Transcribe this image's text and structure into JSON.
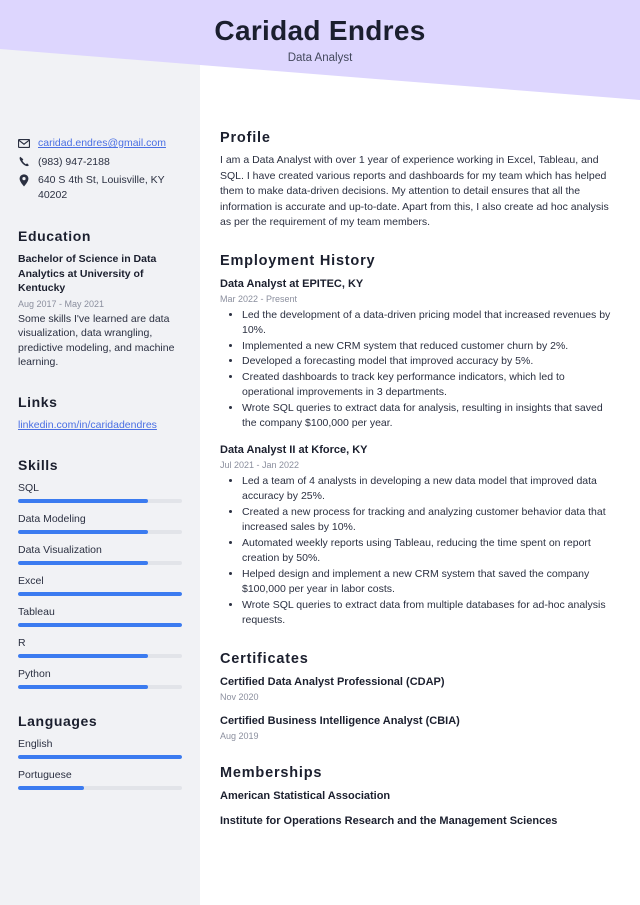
{
  "theme": {
    "band_color": "#ddd6fe",
    "sidebar_color": "#f1f2f5",
    "accent_bar": "#3b7bf0",
    "link_color": "#4a6fe3",
    "text_color": "#2b3041",
    "muted_color": "#8b8f9e"
  },
  "header": {
    "name": "Caridad Endres",
    "role": "Data Analyst"
  },
  "sidebar": {
    "contact": [
      {
        "icon": "envelope-icon",
        "text": "caridad.endres@gmail.com",
        "is_link": true
      },
      {
        "icon": "phone-icon",
        "text": "(983) 947-2188",
        "is_link": false
      },
      {
        "icon": "location-pin-icon",
        "text": "640 S 4th St, Louisville, KY 40202",
        "is_link": false
      }
    ],
    "education": {
      "heading": "Education",
      "title": "Bachelor of Science in Data Analytics at University of Kentucky",
      "date": "Aug 2017 - May 2021",
      "description": "Some skills I've learned are data visualization, data wrangling, predictive modeling, and machine learning."
    },
    "links": {
      "heading": "Links",
      "items": [
        {
          "label": "linkedin.com/in/caridadendres"
        }
      ]
    },
    "skills": {
      "heading": "Skills",
      "items": [
        {
          "label": "SQL",
          "level": 79
        },
        {
          "label": "Data Modeling",
          "level": 79
        },
        {
          "label": "Data Visualization",
          "level": 79
        },
        {
          "label": "Excel",
          "level": 100
        },
        {
          "label": "Tableau",
          "level": 100
        },
        {
          "label": "R",
          "level": 79
        },
        {
          "label": "Python",
          "level": 79
        }
      ]
    },
    "languages": {
      "heading": "Languages",
      "items": [
        {
          "label": "English",
          "level": 100
        },
        {
          "label": "Portuguese",
          "level": 40
        }
      ]
    }
  },
  "main": {
    "profile": {
      "heading": "Profile",
      "text": "I am a Data Analyst with over 1 year of experience working in Excel, Tableau, and SQL. I have created various reports and dashboards for my team which has helped them to make data-driven decisions. My attention to detail ensures that all the information is accurate and up-to-date. Apart from this, I also create ad hoc analysis as per the requirement of my team members."
    },
    "employment": {
      "heading": "Employment History",
      "jobs": [
        {
          "title": "Data Analyst at EPITEC, KY",
          "date": "Mar 2022 - Present",
          "bullets": [
            "Led the development of a data-driven pricing model that increased revenues by 10%.",
            "Implemented a new CRM system that reduced customer churn by 2%.",
            "Developed a forecasting model that improved accuracy by 5%.",
            "Created dashboards to track key performance indicators, which led to operational improvements in 3 departments.",
            "Wrote SQL queries to extract data for analysis, resulting in insights that saved the company $100,000 per year."
          ]
        },
        {
          "title": "Data Analyst II at Kforce, KY",
          "date": "Jul 2021 - Jan 2022",
          "bullets": [
            "Led a team of 4 analysts in developing a new data model that improved data accuracy by 25%.",
            "Created a new process for tracking and analyzing customer behavior data that increased sales by 10%.",
            "Automated weekly reports using Tableau, reducing the time spent on report creation by 50%.",
            "Helped design and implement a new CRM system that saved the company $100,000 per year in labor costs.",
            "Wrote SQL queries to extract data from multiple databases for ad-hoc analysis requests."
          ]
        }
      ]
    },
    "certificates": {
      "heading": "Certificates",
      "items": [
        {
          "title": "Certified Data Analyst Professional (CDAP)",
          "date": "Nov 2020"
        },
        {
          "title": "Certified Business Intelligence Analyst (CBIA)",
          "date": "Aug 2019"
        }
      ]
    },
    "memberships": {
      "heading": "Memberships",
      "items": [
        {
          "title": "American Statistical Association"
        },
        {
          "title": "Institute for Operations Research and the Management Sciences"
        }
      ]
    }
  }
}
